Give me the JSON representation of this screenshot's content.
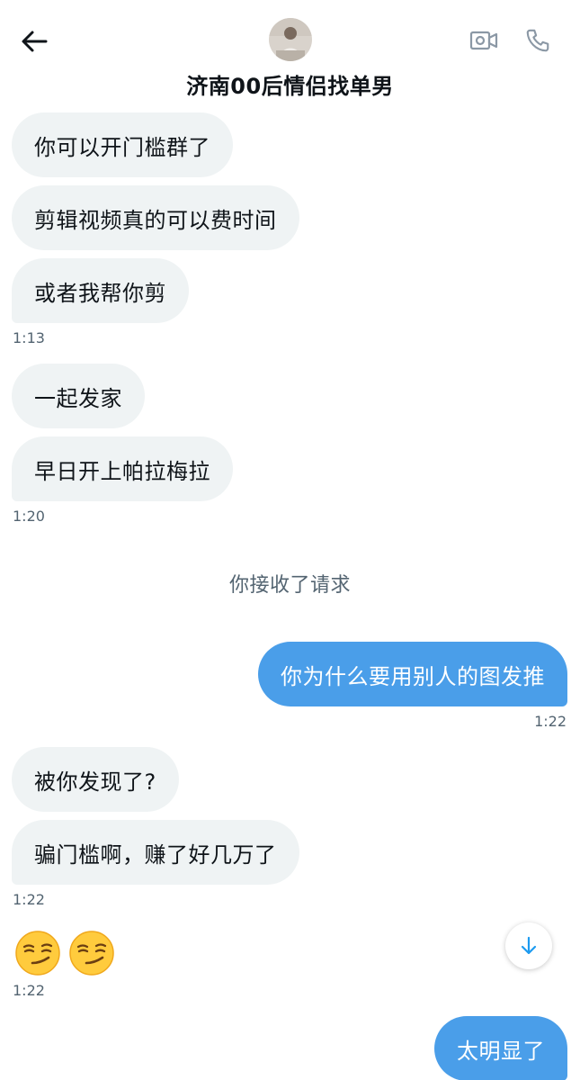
{
  "header": {
    "title": "济南00后情侣找单男"
  },
  "messages": {
    "m1": "你可以开门槛群了",
    "m2": "剪辑视频真的可以费时间",
    "m3": "或者我帮你剪",
    "t1": "1:13",
    "m4": "一起发家",
    "m5": "早日开上帕拉梅拉",
    "t2": "1:20",
    "system": "你接收了请求",
    "m6": "你为什么要用别人的图发推",
    "t3": "1:22",
    "m7": "被你发现了?",
    "m8": "骗门槛啊，赚了好几万了",
    "t4": "1:22",
    "emoji": "😏😏",
    "t5": "1:22",
    "m9": "太明显了"
  },
  "icons": {
    "back": "arrow-left-icon",
    "video": "video-camera-icon",
    "call": "phone-icon",
    "scroll": "arrow-down-icon"
  },
  "colors": {
    "outgoing_bubble": "#4a9ee9",
    "incoming_bubble": "#eff3f4",
    "timestamp": "#536471"
  }
}
